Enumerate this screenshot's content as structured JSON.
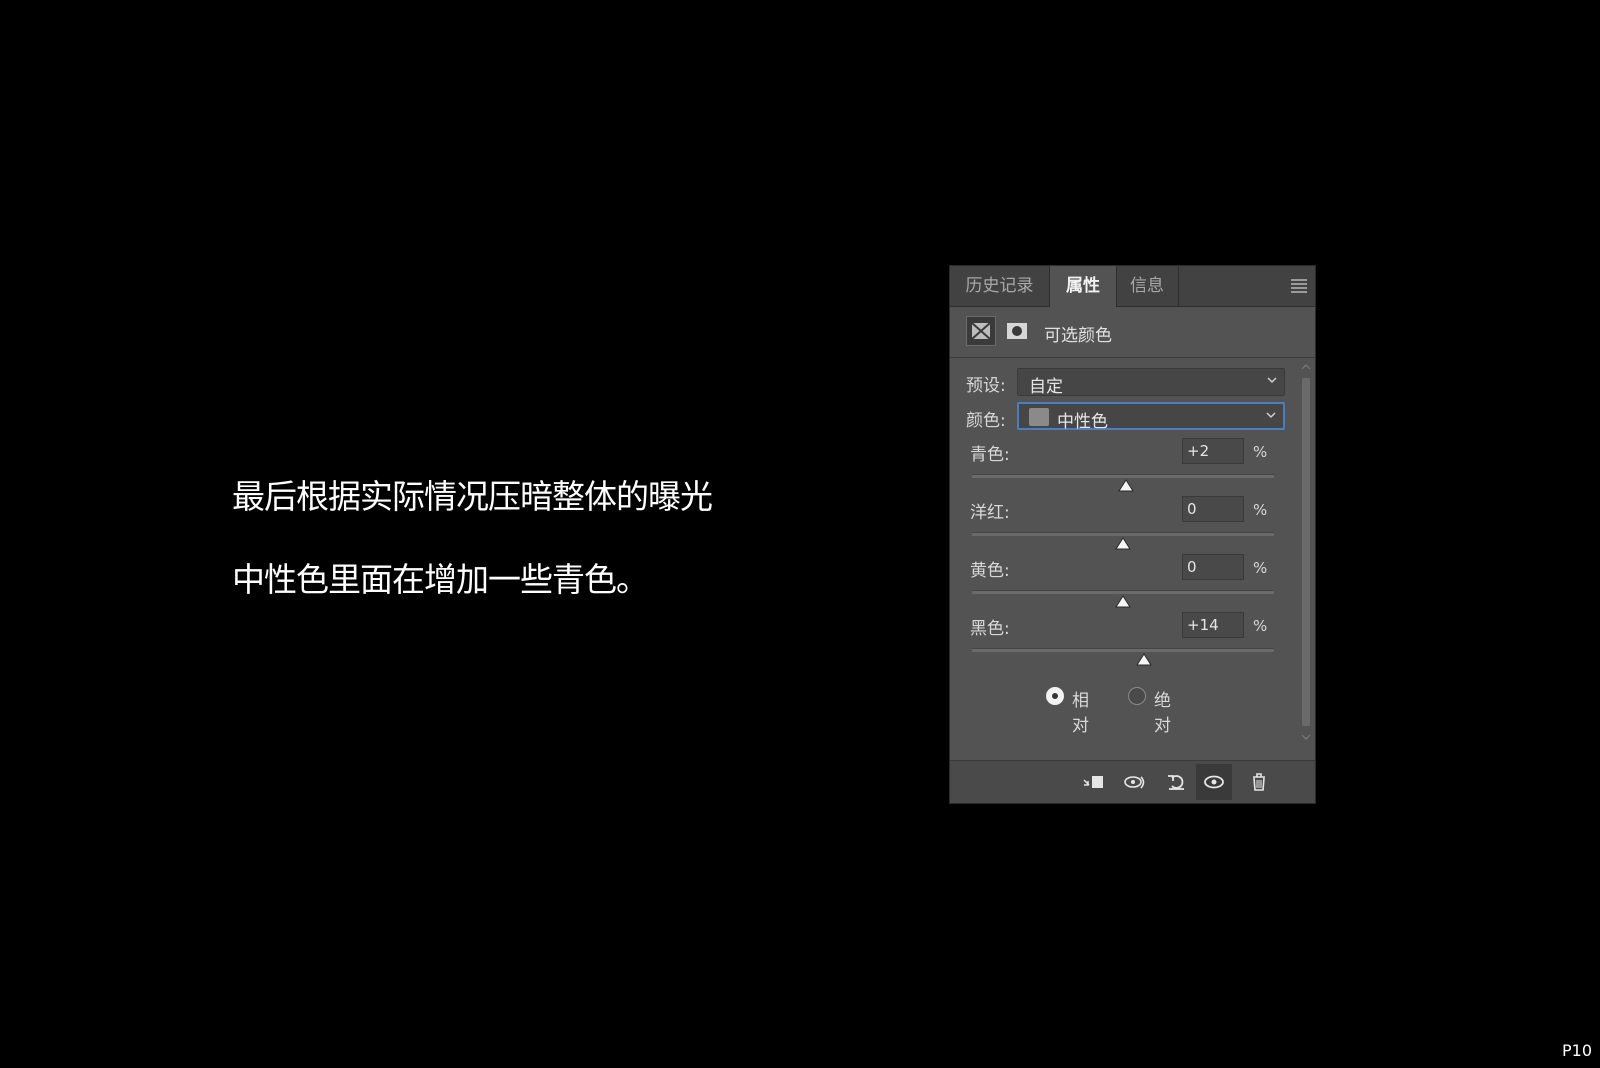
{
  "caption": {
    "line1": "最后根据实际情况压暗整体的曝光",
    "line2": "中性色里面在增加一些青色。"
  },
  "page_number": "P10",
  "panel": {
    "tabs": [
      {
        "label": "历史记录",
        "active": false
      },
      {
        "label": "属性",
        "active": true
      },
      {
        "label": "信息",
        "active": false
      }
    ],
    "title": "可选颜色",
    "preset": {
      "label": "预设:",
      "value": "自定"
    },
    "color": {
      "label": "颜色:",
      "value": "中性色",
      "swatch": "#8a8a8a"
    },
    "sliders": [
      {
        "label": "青色:",
        "value": "+2",
        "unit": "%",
        "level": 2
      },
      {
        "label": "洋红:",
        "value": "0",
        "unit": "%",
        "level": 0
      },
      {
        "label": "黄色:",
        "value": "0",
        "unit": "%",
        "level": 0
      },
      {
        "label": "黑色:",
        "value": "+14",
        "unit": "%",
        "level": 14
      }
    ],
    "method": {
      "relative": {
        "label": "相对",
        "selected": true
      },
      "absolute": {
        "label": "绝对",
        "selected": false
      }
    },
    "footer_buttons": [
      "clip-to-layer-icon",
      "view-previous-state-icon",
      "reset-icon",
      "visibility-eye-icon",
      "trash-icon"
    ],
    "accent": "#4a7ec0"
  }
}
